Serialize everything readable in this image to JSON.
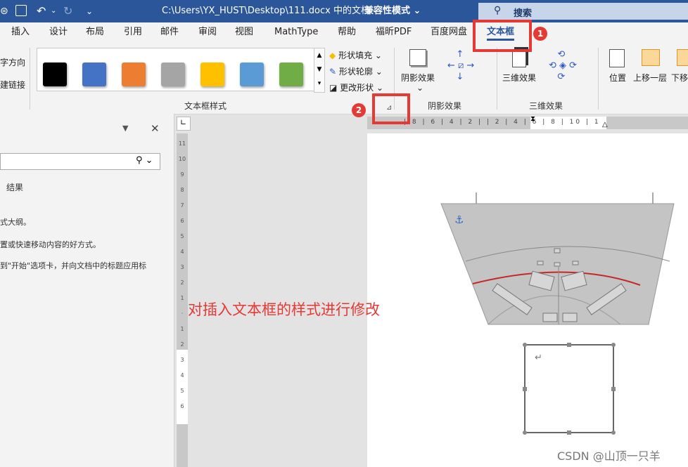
{
  "titlebar": {
    "path": "C:\\Users\\YX_HUST\\Desktop\\111.docx  中的文档  -",
    "mode": "兼容性模式 ⌄",
    "search": "搜索"
  },
  "tabs": [
    "插入",
    "设计",
    "布局",
    "引用",
    "邮件",
    "审阅",
    "视图",
    "MathType",
    "帮助",
    "福昕PDF",
    "百度网盘",
    "文本框"
  ],
  "ribbon": {
    "left_labels": [
      "字方向",
      "建链接"
    ],
    "swatch_colors": [
      "#000000",
      "#4472c4",
      "#ed7d31",
      "#a5a5a5",
      "#ffc000",
      "#5b9bd5",
      "#70ad47"
    ],
    "shape_fill": "形状填充",
    "shape_outline": "形状轮廓",
    "change_shape": "更改形状",
    "group_textbox_styles": "文本框样式",
    "shadow_effects": "阴影效果",
    "group_shadow": "阴影效果",
    "three_d": "三维效果",
    "group_three_d": "三维效果",
    "position": "位置",
    "bring_forward": "上移一层",
    "send_backward": "下移"
  },
  "annotations": {
    "badge1": "1",
    "badge2": "2"
  },
  "navpane": {
    "results": "结果",
    "line1": "式大纲。",
    "line2": "置或快速移动内容的好方式。",
    "line3": "到\"开始\"选项卡，并向文档中的标题应用标"
  },
  "hruler_labels": "| 8 | 6 | 4 | 2 |   | 2 | 4 | 6 | 8 | 10 | 1",
  "vruler_labels": [
    "11",
    "10",
    "9",
    "8",
    "7",
    "6",
    "5",
    "4",
    "3",
    "2",
    "1",
    "",
    "1",
    "2",
    "3",
    "4",
    "5",
    "6"
  ],
  "overlay_text": "对插入文本框的样式进行修改",
  "watermark": "CSDN @山顶一只羊",
  "doc": {
    "return_mark": "↵",
    "anchor": "⚓"
  }
}
